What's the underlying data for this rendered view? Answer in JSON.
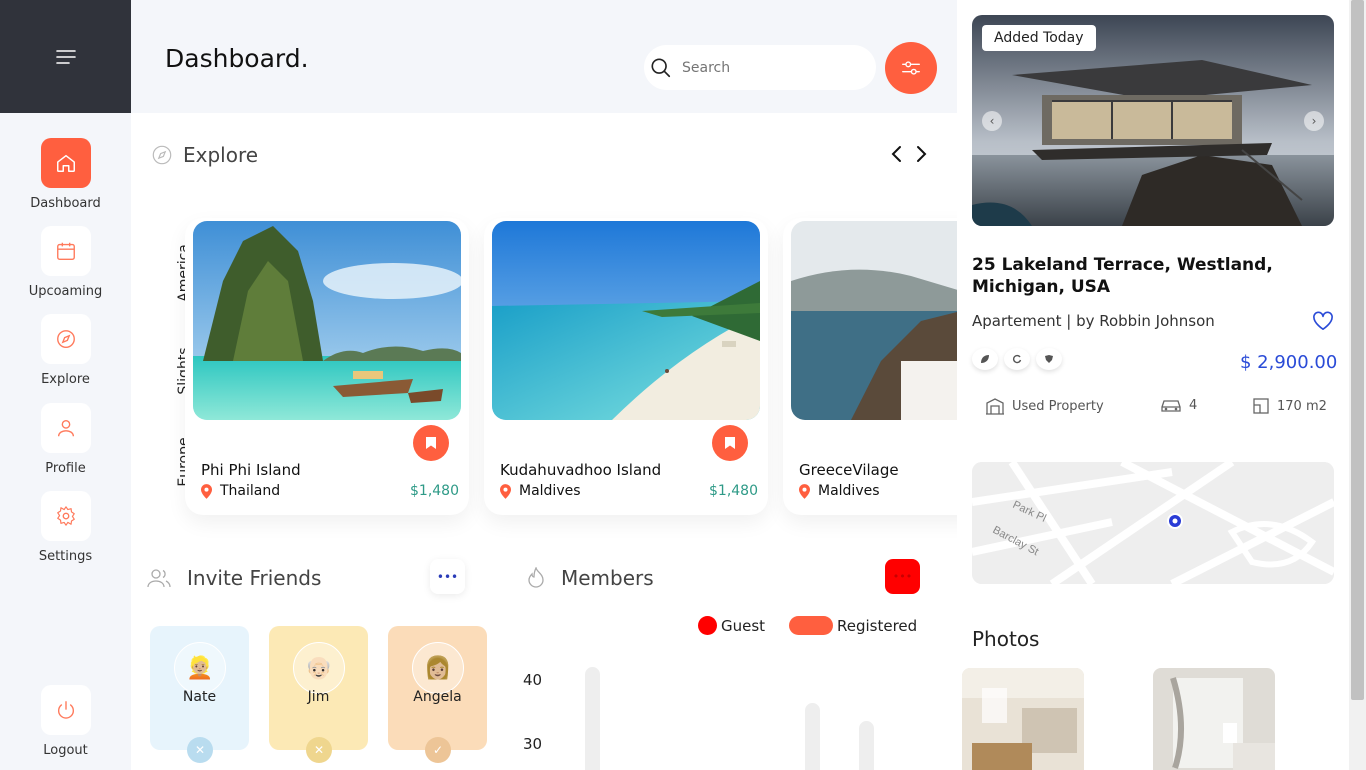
{
  "header": {
    "title": "Dashboard.",
    "search_placeholder": "Search"
  },
  "sidebar": {
    "items": [
      {
        "label": "Dashboard",
        "icon": "home-icon",
        "active": true
      },
      {
        "label": "Upcoaming",
        "icon": "calendar-icon",
        "active": false
      },
      {
        "label": "Explore",
        "icon": "compass-icon",
        "active": false
      },
      {
        "label": "Profile",
        "icon": "user-icon",
        "active": false
      },
      {
        "label": "Settings",
        "icon": "gear-icon",
        "active": false
      }
    ],
    "logout_label": "Logout"
  },
  "explore": {
    "title": "Explore",
    "tabs": [
      "America",
      "Slights",
      "Europe"
    ],
    "cards": [
      {
        "name": "Phi Phi Island",
        "location": "Thailand",
        "price": "$1,480"
      },
      {
        "name": "Kudahuvadhoo Island",
        "location": "Maldives",
        "price": "$1,480"
      },
      {
        "name": "GreeceVilage",
        "location": "Maldives",
        "price": ""
      }
    ]
  },
  "friends": {
    "title": "Invite Friends",
    "more": "•••",
    "items": [
      {
        "name": "Nate",
        "avatar": "👱🏼",
        "badge": "✕"
      },
      {
        "name": "Jim",
        "avatar": "👴🏻",
        "badge": "✕"
      },
      {
        "name": "Angela",
        "avatar": "👩🏼",
        "badge": "✓"
      }
    ]
  },
  "members": {
    "title": "Members",
    "more": "•••",
    "legend": [
      {
        "label": "Guest",
        "color": "#ff0000"
      },
      {
        "label": "Registered",
        "color": "#ff5f3f"
      }
    ],
    "y_ticks": [
      "40",
      "30"
    ]
  },
  "property": {
    "badge": "Added Today",
    "address": "25 Lakeland Terrace, Westland, Michigan, USA",
    "subtitle": "Apartement | by Robbin Johnson",
    "price": "$ 2,900.00",
    "features": [
      {
        "label": "Used Property",
        "icon": "building-icon"
      },
      {
        "label": "4",
        "icon": "car-icon"
      },
      {
        "label": "170 m2",
        "icon": "area-icon"
      }
    ],
    "map_labels": [
      "Park Pl",
      "Barclay St"
    ],
    "photos_title": "Photos"
  },
  "colors": {
    "accent": "#ff5f3f",
    "price_blue": "#2a4bd7",
    "price_green": "#2e9a87",
    "sidebar_dark": "#30333b"
  }
}
